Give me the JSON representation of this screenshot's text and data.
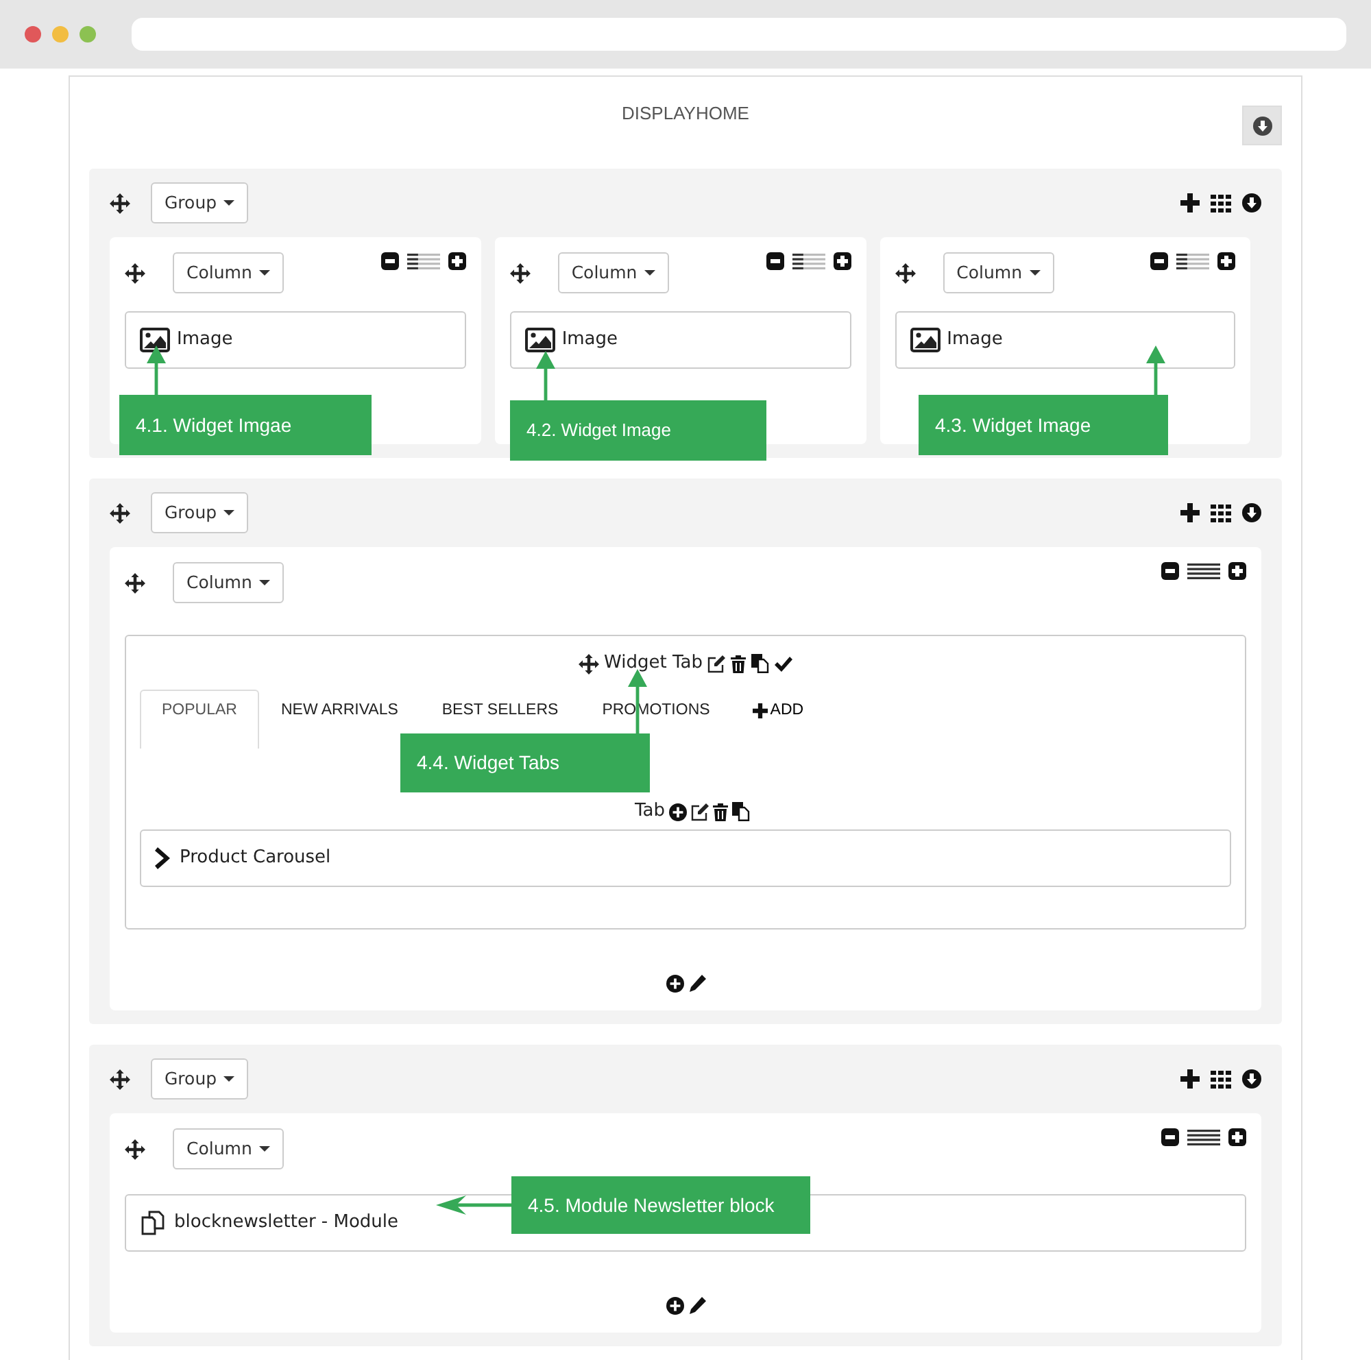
{
  "title": "DISPLAYHOME",
  "groups": [
    {
      "label": "Group",
      "columns": [
        {
          "label": "Column",
          "level": 0.33,
          "widgets": [
            {
              "kind": "image",
              "label": "Image"
            }
          ]
        },
        {
          "label": "Column",
          "level": 0.33,
          "widgets": [
            {
              "kind": "image",
              "label": "Image"
            }
          ]
        },
        {
          "label": "Column",
          "level": 0.33,
          "widgets": [
            {
              "kind": "image",
              "label": "Image"
            }
          ]
        }
      ]
    },
    {
      "label": "Group",
      "columns": [
        {
          "label": "Column",
          "level": 1,
          "tools": true,
          "widgets": [
            {
              "kind": "tabs",
              "title": "Widget Tab",
              "tabs": [
                {
                  "label": "POPULAR",
                  "selected": true
                },
                {
                  "label": "NEW ARRIVALS",
                  "selected": false
                },
                {
                  "label": "BEST SELLERS",
                  "selected": false
                },
                {
                  "label": "PROMOTIONS",
                  "selected": false
                }
              ],
              "add_label": "ADD",
              "tab_label": "Tab",
              "items": [
                {
                  "label": "Product Carousel"
                }
              ]
            }
          ]
        }
      ]
    },
    {
      "label": "Group",
      "columns": [
        {
          "label": "Column",
          "level": 1,
          "tools": true,
          "widgets": [
            {
              "kind": "module",
              "label": "blocknewsletter - Module"
            }
          ]
        }
      ]
    }
  ],
  "callouts": [
    {
      "text": "4.1. Widget Imgae",
      "kind": "up"
    },
    {
      "text": "4.2. Widget Image",
      "kind": "up"
    },
    {
      "text": "4.3. Widget Image",
      "kind": "up"
    },
    {
      "text": "4.4. Widget Tabs",
      "kind": "up"
    },
    {
      "text": "4.5. Module Newsletter block",
      "kind": "left"
    }
  ]
}
